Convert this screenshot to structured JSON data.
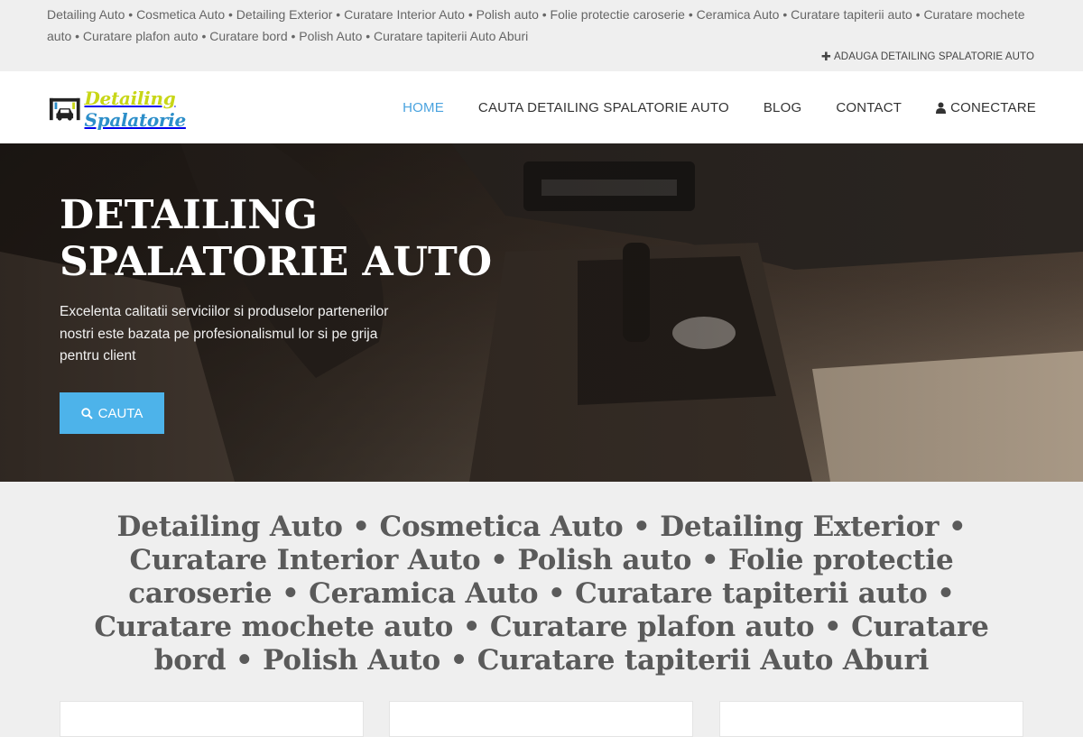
{
  "topbar": {
    "tags": "Detailing Auto • Cosmetica Auto • Detailing Exterior • Curatare Interior Auto • Polish auto • Folie protectie caroserie • Ceramica Auto • Curatare tapiterii auto • Curatare mochete auto • Curatare plafon auto • Curatare bord • Polish Auto • Curatare tapiterii Auto Aburi",
    "add_link": "ADAUGA DETAILING SPALATORIE AUTO",
    "add_icon": "plus-icon"
  },
  "header": {
    "logo_word1": "Detailing",
    "logo_word2": "Spalatorie",
    "logo_icon": "car-wash-icon",
    "colors": {
      "logo_green": "#c8d617",
      "logo_blue": "#2c8ec9",
      "nav_active": "#4aa3df"
    },
    "nav": [
      {
        "label": "HOME",
        "active": true
      },
      {
        "label": "CAUTA DETAILING SPALATORIE AUTO",
        "active": false
      },
      {
        "label": "BLOG",
        "active": false
      },
      {
        "label": "CONTACT",
        "active": false
      },
      {
        "label": "CONECTARE",
        "active": false,
        "icon": "user-icon"
      }
    ]
  },
  "hero": {
    "title_line1": "DETAILING",
    "title_line2": "SPALATORIE AUTO",
    "subtitle": "Excelenta calitatii serviciilor si produselor partenerilor nostri este bazata pe profesionalismul lor si pe grija pentru client",
    "button_label": "CAUTA",
    "button_icon": "search-icon",
    "button_color": "#4db3ea"
  },
  "main": {
    "heading": "Detailing Auto • Cosmetica Auto • Detailing Exterior • Curatare Interior Auto • Polish auto • Folie protectie caroserie • Ceramica Auto • Curatare tapiterii auto • Curatare mochete auto • Curatare plafon auto • Curatare bord • Polish Auto • Curatare tapiterii Auto Aburi"
  }
}
